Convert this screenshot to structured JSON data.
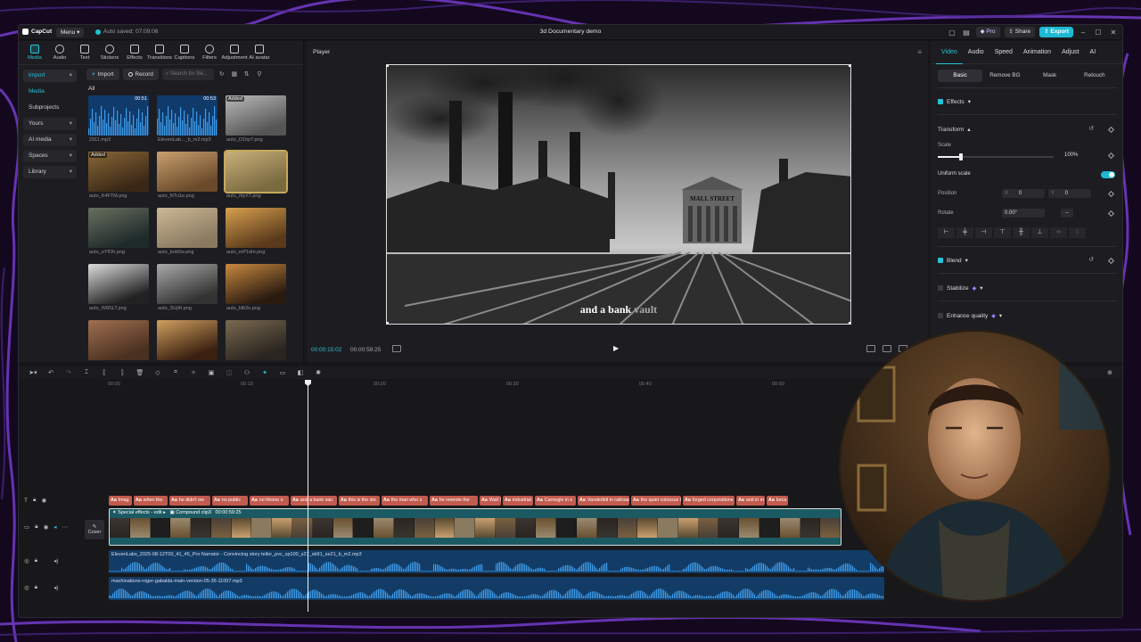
{
  "app": {
    "logo": "CapCut",
    "menu_label": "Menu",
    "autosave": "Auto saved: 07:09:06",
    "doc_title": "3d Documentary demo",
    "pro_label": "Pro",
    "share_label": "Share",
    "export_label": "Export"
  },
  "toolbar": {
    "items": [
      "Media",
      "Audio",
      "Text",
      "Stickers",
      "Effects",
      "Transitions",
      "Captions",
      "Filters",
      "Adjustment",
      "AI avatar"
    ]
  },
  "sidebar": {
    "import_label": "Import",
    "items": [
      "Media",
      "Subprojects",
      "Yours",
      "AI media",
      "Spaces",
      "Library"
    ]
  },
  "media": {
    "import_btn": "Import",
    "record_btn": "Record",
    "search_placeholder": "Search for file...",
    "all_label": "All",
    "items": [
      {
        "name": "2311.mp3",
        "dur": "00:51",
        "added": ""
      },
      {
        "name": "ElevenLab..._b_m2.mp3",
        "dur": "00:53",
        "added": ""
      },
      {
        "name": "auto_O1hpT.png",
        "dur": "",
        "added": "Added"
      },
      {
        "name": "auto_K4FTM.png",
        "dur": "",
        "added": "Added"
      },
      {
        "name": "auto_NTu1e.png",
        "dur": "",
        "added": ""
      },
      {
        "name": "auto_rbyXT.png",
        "dur": "",
        "added": ""
      },
      {
        "name": "auto_eYfOh.png",
        "dur": "",
        "added": ""
      },
      {
        "name": "auto_bnb5w.png",
        "dur": "",
        "added": ""
      },
      {
        "name": "auto_mP1dm.png",
        "dur": "",
        "added": ""
      },
      {
        "name": "auto_W8SLT.png",
        "dur": "",
        "added": ""
      },
      {
        "name": "auto_SUj4I.png",
        "dur": "",
        "added": ""
      },
      {
        "name": "auto_blb2o.png",
        "dur": "",
        "added": ""
      },
      {
        "name": "",
        "dur": "",
        "added": ""
      },
      {
        "name": "",
        "dur": "",
        "added": ""
      },
      {
        "name": "",
        "dur": "",
        "added": ""
      }
    ]
  },
  "player": {
    "title": "Player",
    "caption_main": "and a bank",
    "caption_dim": "vault",
    "sign_text": "MALL STREET",
    "time_current": "00:00:15:02",
    "time_total": "00:00:59:25"
  },
  "inspector": {
    "tabs": [
      "Video",
      "Audio",
      "Speed",
      "Animation",
      "Adjust",
      "AI"
    ],
    "subtabs": [
      "Basic",
      "Remove BG",
      "Mask",
      "Retouch"
    ],
    "effects_label": "Effects",
    "transform_label": "Transform",
    "scale_label": "Scale",
    "scale_value": "100%",
    "scale_fraction": 0.2,
    "uniform_label": "Uniform scale",
    "position_label": "Position",
    "pos_x_label": "X",
    "pos_x": "0",
    "pos_y_label": "Y",
    "pos_y": "0",
    "rotate_label": "Rotate",
    "rotate_value": "0.00°",
    "blend_label": "Blend",
    "stabilize_label": "Stabilize",
    "enhance_label": "Enhance quality"
  },
  "timeline": {
    "ruler": [
      "00:00",
      "00:10",
      "00:20",
      "00:30",
      "00:40",
      "00:50"
    ],
    "text_clips": [
      "Imag",
      "when the",
      "he didn't ow",
      "no public",
      "no throne o",
      "and a bank vau",
      "this is the sto",
      "the man who s",
      "he rewrote the",
      "Wall S",
      "industrial",
      "Carnegie in s",
      "Vanderbilt in railroads",
      "the quiet colossus t",
      "forged corporations",
      "and in m",
      "beca"
    ],
    "text_clip_prefix": "Aa",
    "video_label_effects": "Special effects - edit",
    "video_label_compound": "Compound clip3",
    "video_label_dur": "00:00:59:25",
    "cover_label": "Cover",
    "audio1_label": "ElevenLabs_2025-08-12T00_41_45_Pro Narrator - Convincing story teller_pvc_sp100_s27_sb91_se21_b_m2.mp3",
    "audio2_label": "machinations-roger-gabalda-main-version-05-35-11007.mp3"
  }
}
